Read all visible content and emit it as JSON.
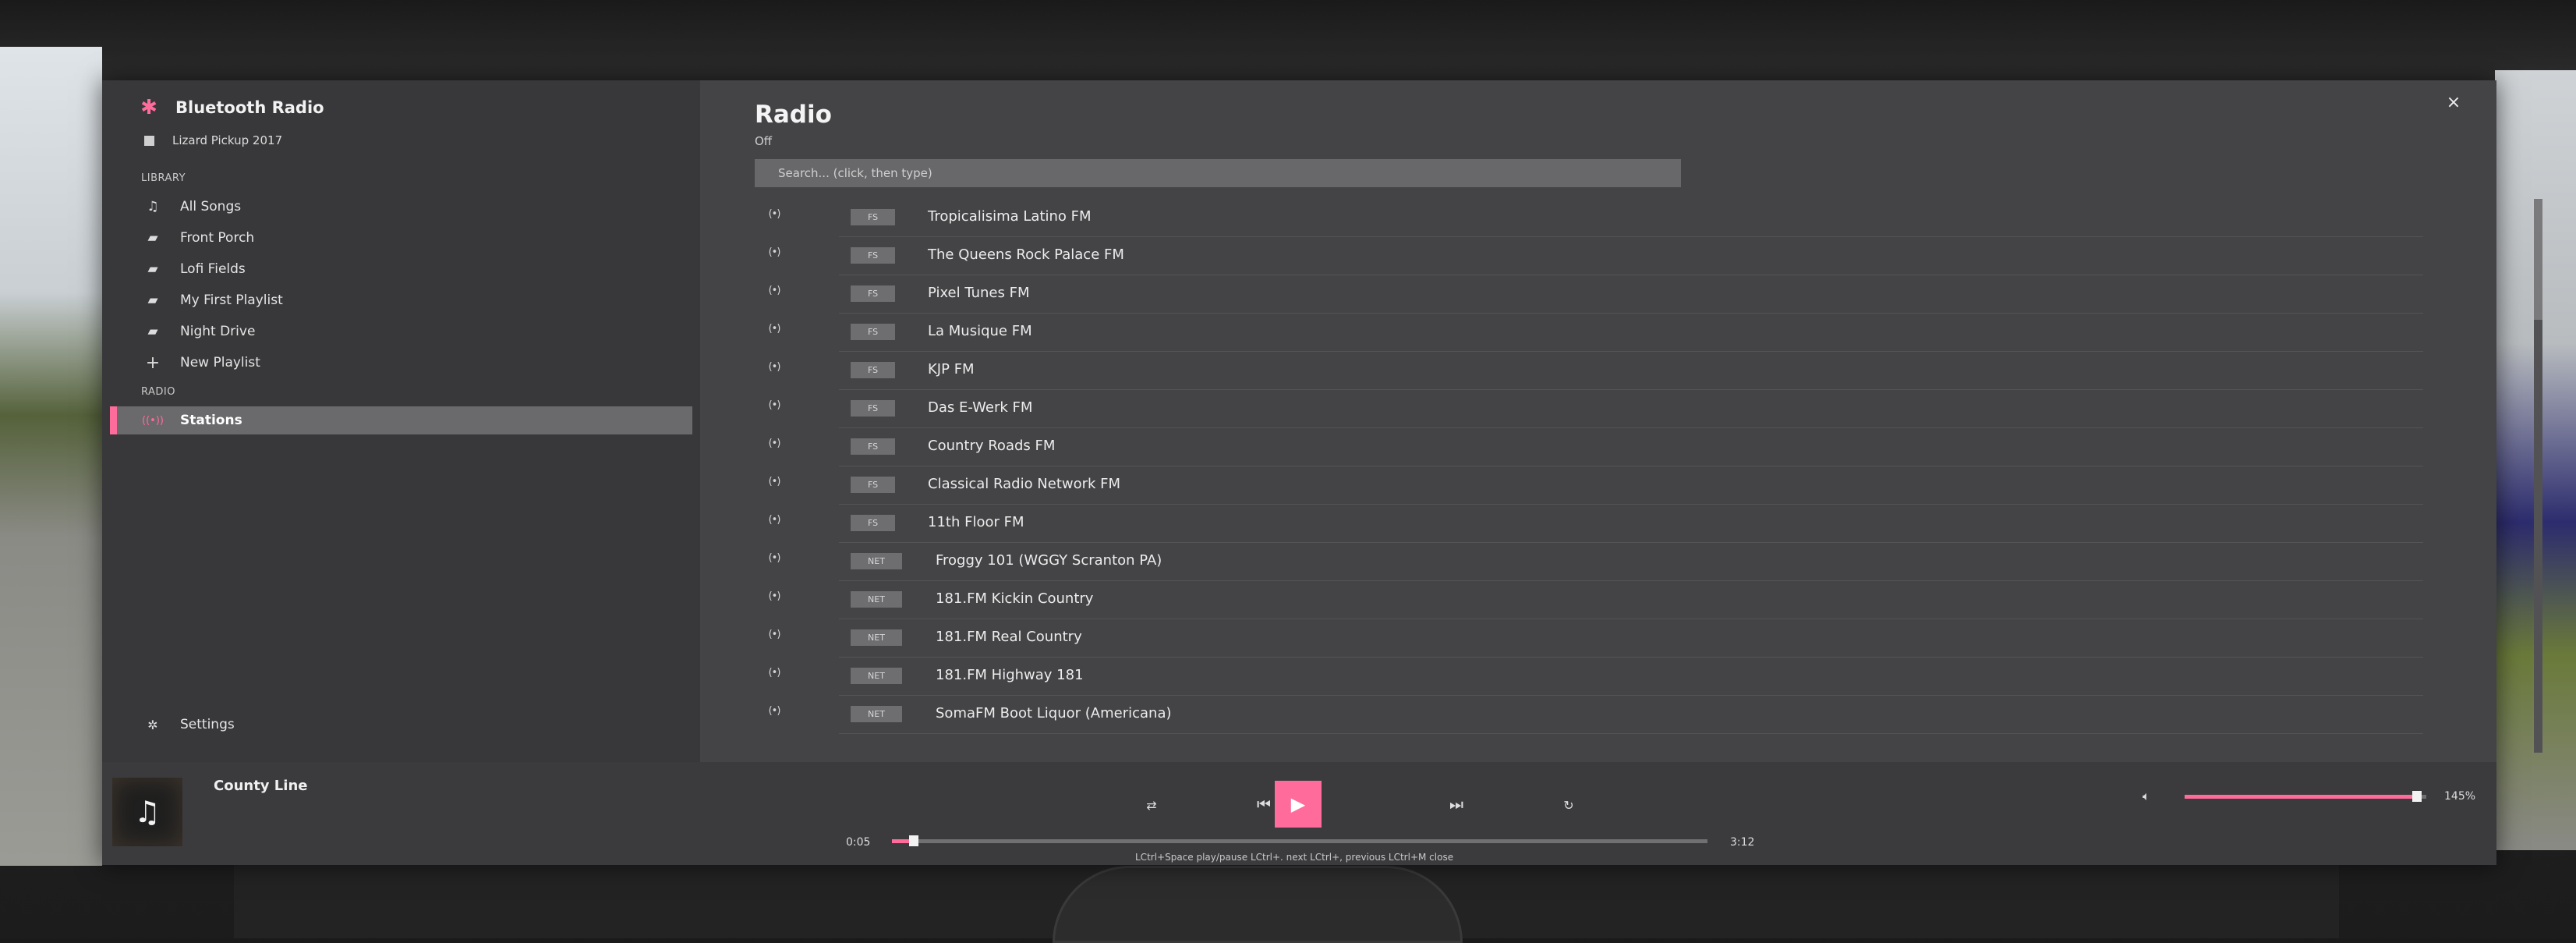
{
  "app": {
    "title": "Bluetooth Radio",
    "vehicle": "Lizard Pickup 2017",
    "icon": "bluetooth-icon",
    "accent_color": "#ff6b9a"
  },
  "sidebar": {
    "library_label": "LIBRARY",
    "library_items": [
      {
        "label": "All Songs",
        "icon": "music-note-icon"
      },
      {
        "label": "Front Porch",
        "icon": "folder-icon"
      },
      {
        "label": "Lofi Fields",
        "icon": "folder-icon"
      },
      {
        "label": "My First Playlist",
        "icon": "folder-icon"
      },
      {
        "label": "Night Drive",
        "icon": "folder-icon"
      },
      {
        "label": "New Playlist",
        "icon": "plus-icon"
      }
    ],
    "radio_label": "RADIO",
    "radio_items": [
      {
        "label": "Stations",
        "icon": "radio-waves-icon",
        "active": true
      }
    ],
    "settings_label": "Settings"
  },
  "main": {
    "title": "Radio",
    "subtitle": "Off",
    "search_placeholder": "Search... (click, then type)",
    "close_label": "×",
    "stations": [
      {
        "type": "FS",
        "name": "Tropicalisima Latino FM"
      },
      {
        "type": "FS",
        "name": "The Queens Rock Palace FM"
      },
      {
        "type": "FS",
        "name": "Pixel Tunes FM"
      },
      {
        "type": "FS",
        "name": "La Musique FM"
      },
      {
        "type": "FS",
        "name": "KJP FM"
      },
      {
        "type": "FS",
        "name": "Das E-Werk FM"
      },
      {
        "type": "FS",
        "name": "Country Roads FM"
      },
      {
        "type": "FS",
        "name": "Classical Radio Network FM"
      },
      {
        "type": "FS",
        "name": "11th Floor FM"
      },
      {
        "type": "NET",
        "name": "Froggy 101 (WGGY Scranton PA)"
      },
      {
        "type": "NET",
        "name": "181.FM Kickin Country"
      },
      {
        "type": "NET",
        "name": "181.FM Real Country"
      },
      {
        "type": "NET",
        "name": "181.FM Highway 181"
      },
      {
        "type": "NET",
        "name": "SomaFM Boot Liquor (Americana)"
      }
    ]
  },
  "player": {
    "track": "County Line",
    "elapsed": "0:05",
    "duration": "3:12",
    "progress_fraction": 0.027,
    "hints": "LCtrl+Space play/pause   LCtrl+. next   LCtrl+, previous   LCtrl+M close",
    "volume_label": "145%",
    "volume_fraction": 0.96,
    "icons": {
      "shuffle": "shuffle-icon",
      "prev": "previous-icon",
      "play": "play-icon",
      "next": "next-icon",
      "repeat": "repeat-icon",
      "volume": "volume-icon",
      "art": "music-note-icon"
    }
  }
}
